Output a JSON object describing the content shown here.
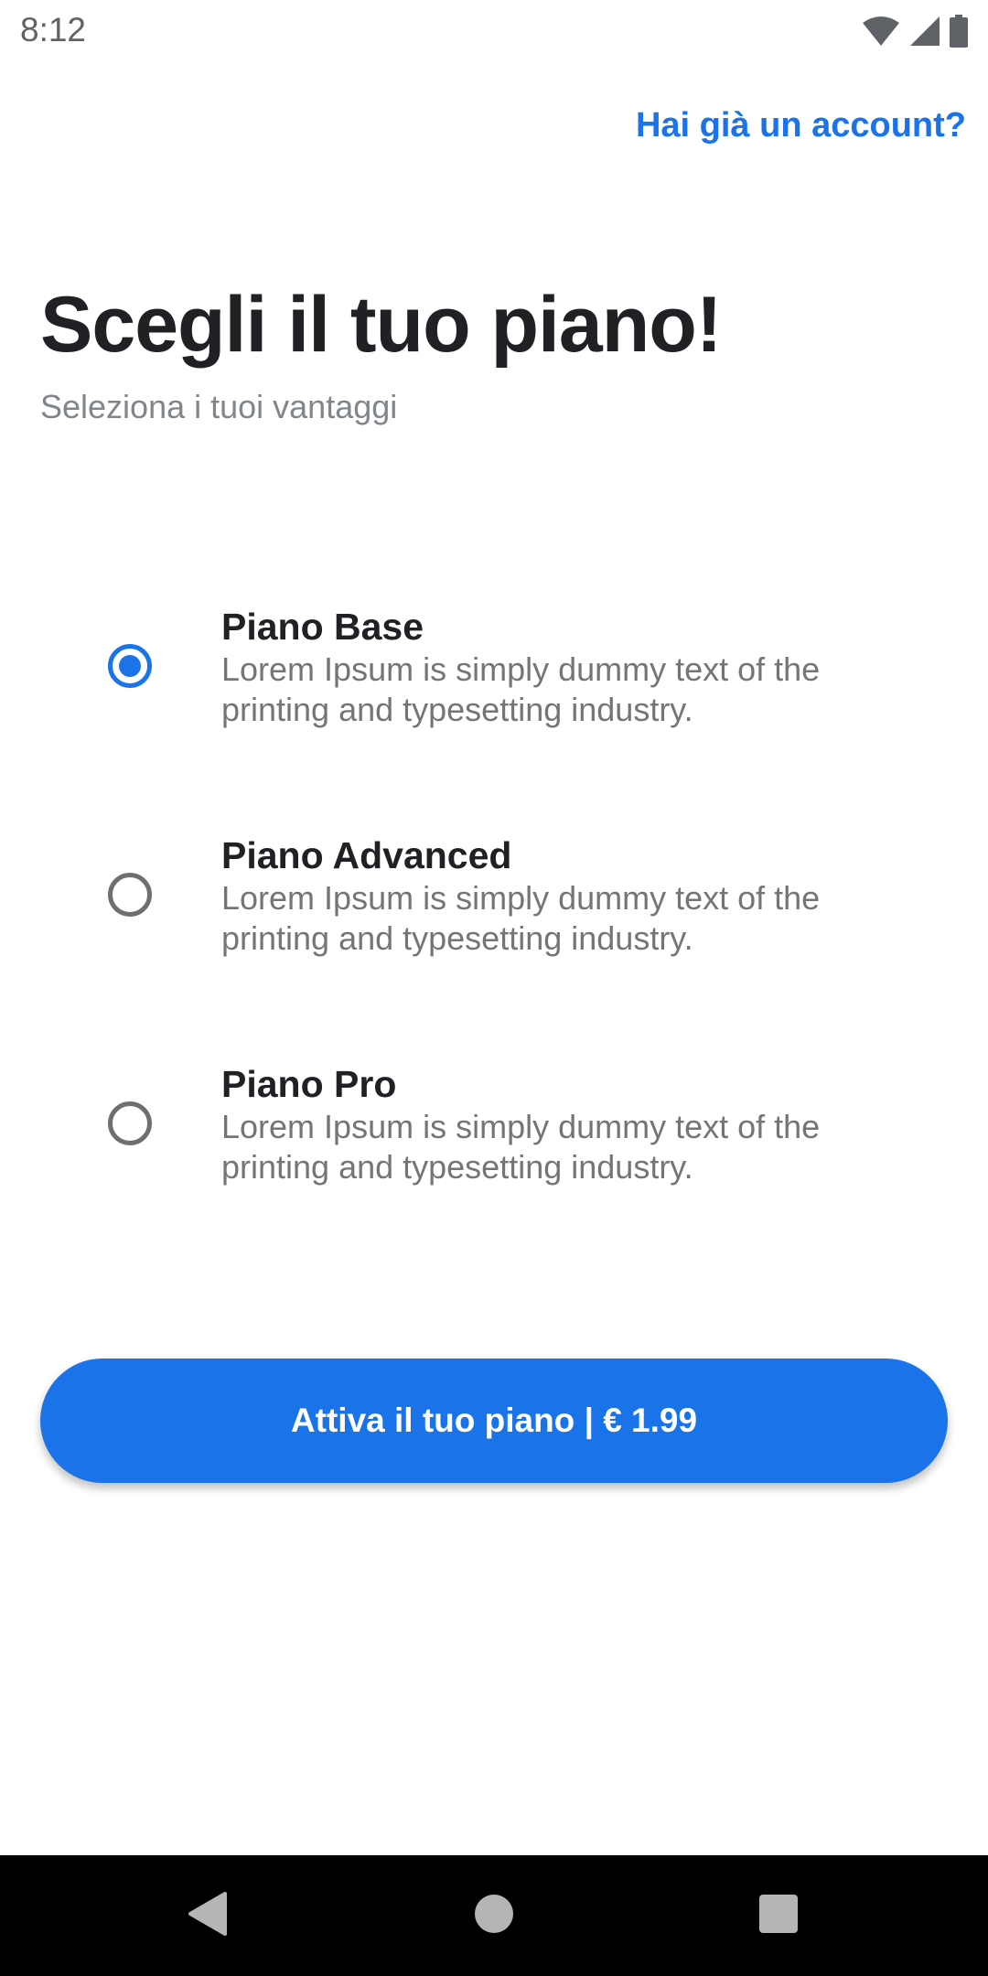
{
  "status_bar": {
    "time": "8:12",
    "icons": [
      "wifi-icon",
      "cell-signal-icon",
      "battery-icon"
    ]
  },
  "header": {
    "login_link": "Hai già un account?"
  },
  "main": {
    "title": "Scegli il tuo piano!",
    "subtitle": "Seleziona i tuoi vantaggi",
    "plans": [
      {
        "name": "Piano Base",
        "description": "Lorem Ipsum is simply dummy text of the printing and typesetting industry.",
        "selected": true
      },
      {
        "name": "Piano Advanced",
        "description": "Lorem Ipsum is simply dummy text of the printing and typesetting industry.",
        "selected": false
      },
      {
        "name": "Piano Pro",
        "description": "Lorem Ipsum is simply dummy text of the printing and typesetting industry.",
        "selected": false
      }
    ],
    "cta_label": "Attiva il tuo piano | € 1.99"
  },
  "nav_bar": {
    "icons": [
      "back-icon",
      "home-icon",
      "recents-icon"
    ]
  },
  "colors": {
    "accent": "#1a73e8",
    "title": "#202124",
    "subtitle": "#80868b",
    "description": "#757575",
    "nav_bar": "#000000"
  }
}
